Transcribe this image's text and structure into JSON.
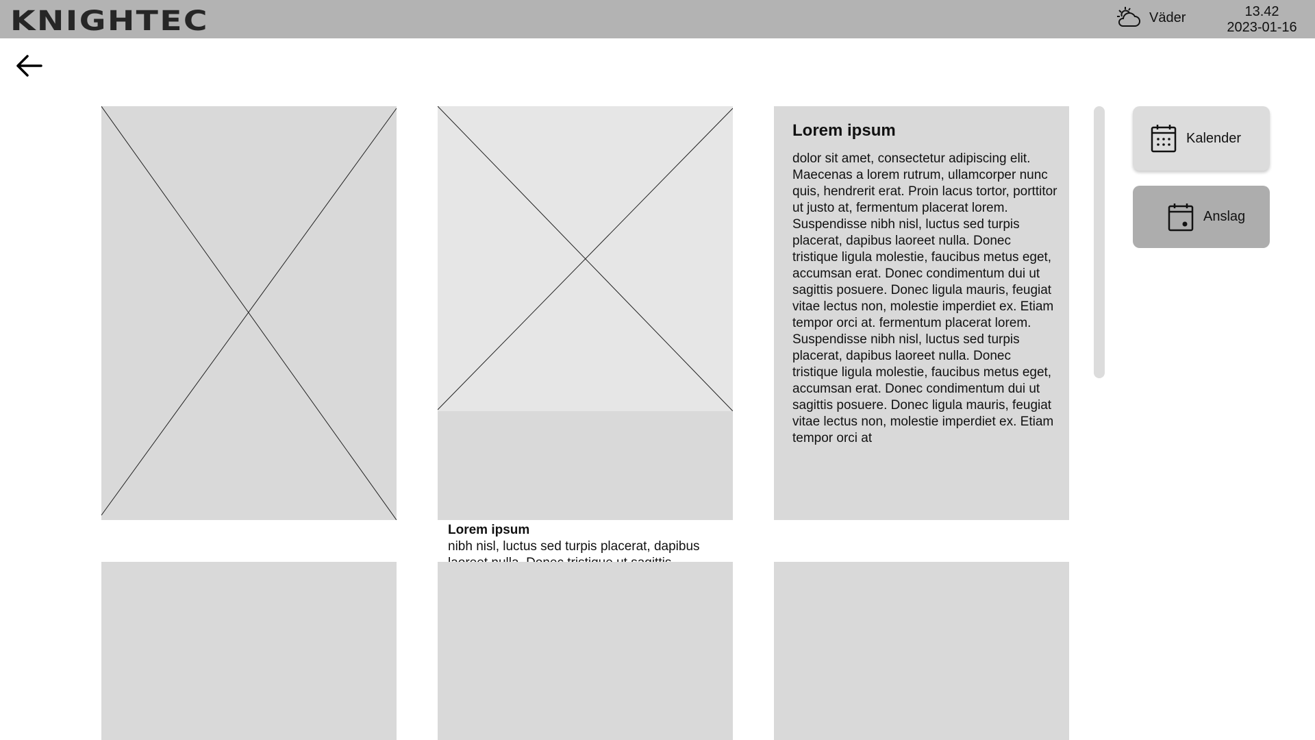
{
  "header": {
    "logo": "KNIGHTEC",
    "weather_label": "Väder",
    "weather_icon": "partly-cloudy-icon",
    "time": "13.42",
    "date": "2023-01-16"
  },
  "nav": {
    "back_icon": "arrow-left-icon"
  },
  "cards": {
    "image_card": {
      "icon": "image-placeholder"
    },
    "caption_card": {
      "title": "Lorem ipsum",
      "body": "nibh nisl, luctus sed turpis placerat, dapibus laoreet nulla. Donec tristique ut sagittis posuere. Donec ligula mauris, feugiat vitae lectus non, molestie"
    },
    "text_card": {
      "title": "Lorem ipsum",
      "body": "dolor sit amet, consectetur adipiscing elit. Maecenas a lorem rutrum, ullamcorper nunc quis, hendrerit erat. Proin lacus tortor, porttitor ut justo at, fermentum placerat lorem. Suspendisse nibh nisl, luctus sed turpis placerat, dapibus laoreet nulla. Donec tristique ligula molestie, faucibus metus eget, accumsan erat. Donec condimentum dui ut sagittis posuere. Donec ligula mauris, feugiat vitae lectus non, molestie imperdiet ex. Etiam tempor orci at. fermentum placerat lorem. Suspendisse nibh nisl, luctus sed turpis placerat, dapibus laoreet nulla. Donec tristique ligula molestie, faucibus metus eget, accumsan erat. Donec condimentum dui ut sagittis posuere. Donec ligula mauris, feugiat vitae lectus non, molestie imperdiet ex. Etiam tempor orci at"
    }
  },
  "sidebar": {
    "buttons": [
      {
        "label": "Kalender",
        "icon": "calendar-icon"
      },
      {
        "label": "Anslag",
        "icon": "calendar-event-icon"
      }
    ]
  },
  "colors": {
    "header": "#b3b3b3",
    "card": "#d9d9d9",
    "active_button": "#adadad"
  }
}
